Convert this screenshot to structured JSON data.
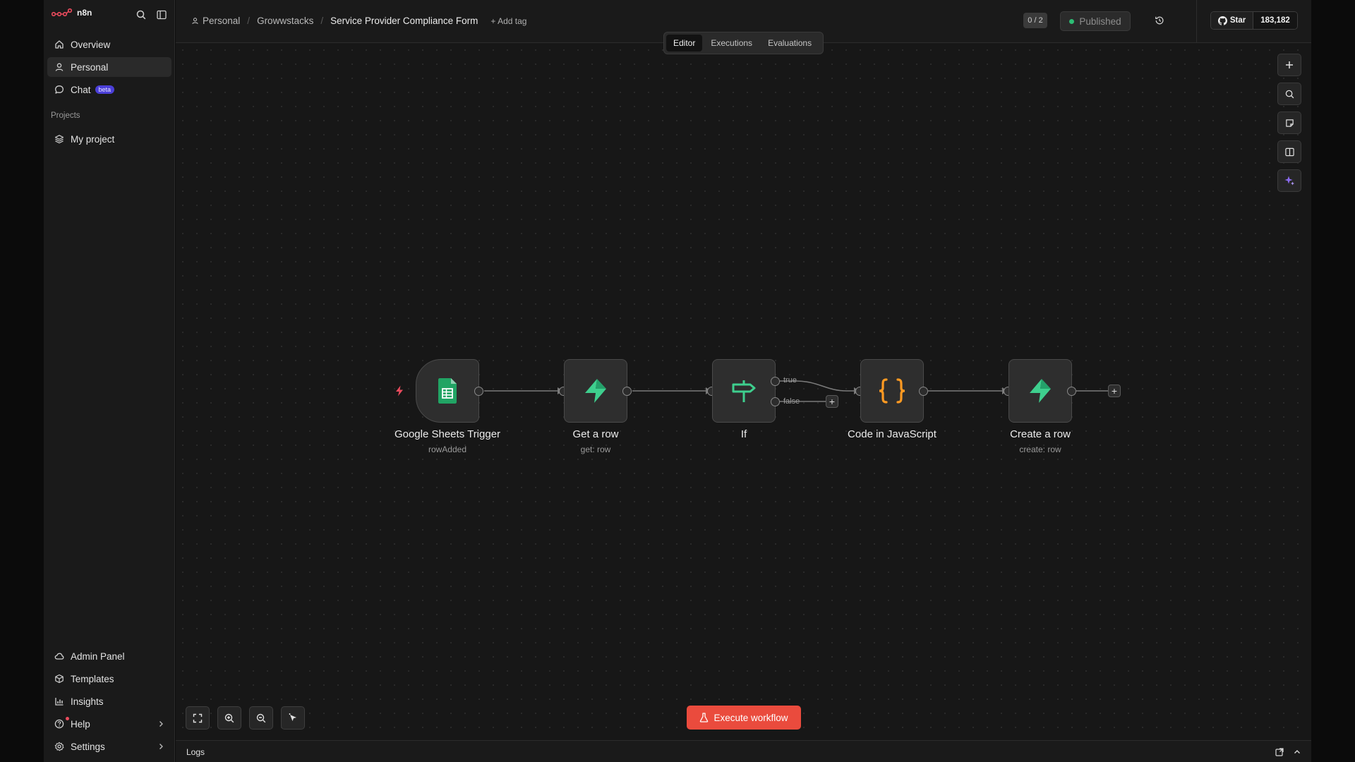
{
  "app": {
    "logo_text": "n8n"
  },
  "sidebar": {
    "nav": [
      {
        "label": "Overview",
        "icon": "home-icon"
      },
      {
        "label": "Personal",
        "icon": "user-icon",
        "active": true
      },
      {
        "label": "Chat",
        "icon": "chat-icon",
        "badge": "beta"
      }
    ],
    "projects_label": "Projects",
    "projects": [
      {
        "label": "My project",
        "icon": "layers-icon"
      }
    ],
    "bottom": [
      {
        "label": "Admin Panel",
        "icon": "cloud-icon"
      },
      {
        "label": "Templates",
        "icon": "box-icon"
      },
      {
        "label": "Insights",
        "icon": "chart-icon"
      },
      {
        "label": "Help",
        "icon": "help-icon"
      },
      {
        "label": "Settings",
        "icon": "gear-icon"
      }
    ]
  },
  "header": {
    "breadcrumb": [
      "Personal",
      "Growwstacks"
    ],
    "workflow_name": "Service Provider Compliance Form",
    "add_tag": "+ Add tag",
    "count_badge": "0 / 2",
    "status": "Published",
    "github": {
      "star_label": "Star",
      "star_count": "183,182"
    }
  },
  "tabs": {
    "items": [
      "Editor",
      "Executions",
      "Evaluations"
    ],
    "active": "Editor"
  },
  "workflow": {
    "nodes": [
      {
        "title": "Google Sheets Trigger",
        "subtitle": "rowAdded",
        "icon": "google-sheets-icon"
      },
      {
        "title": "Get a row",
        "subtitle": "get: row",
        "icon": "supabase-icon"
      },
      {
        "title": "If",
        "subtitle": "",
        "icon": "signpost-icon"
      },
      {
        "title": "Code in JavaScript",
        "subtitle": "",
        "icon": "code-braces-icon"
      },
      {
        "title": "Create a row",
        "subtitle": "create: row",
        "icon": "supabase-icon"
      }
    ],
    "branches": {
      "true": "true",
      "false": "false"
    }
  },
  "execute": {
    "label": "Execute workflow"
  },
  "logs": {
    "label": "Logs"
  },
  "colors": {
    "accent": "#ea4b3d",
    "published": "#2dbd74",
    "sheets": "#21a464",
    "supabase": "#3ecf8e",
    "code": "#ff9a22",
    "beta": "#4b3fd8"
  }
}
